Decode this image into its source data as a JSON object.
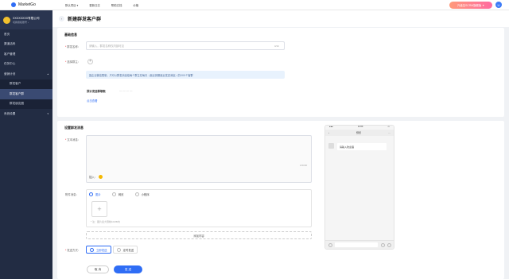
{
  "topbar": {
    "brand": "MarketGo",
    "nav": [
      "默认项目 ▾",
      "更新日志",
      "帮助文档",
      "价格"
    ],
    "upgrade": "升级至SCRM旗舰版 ✦",
    "avatar": "U"
  },
  "sidebar": {
    "org_name": "XXXXXXXX有限公司",
    "org_sub": "切换授权账号 ›",
    "items": [
      {
        "label": "首页"
      },
      {
        "label": "渠道活码"
      },
      {
        "label": "客户管理"
      },
      {
        "label": "任务中心"
      },
      {
        "label": "营销计划",
        "chev": "▴"
      },
      {
        "label": "群发客户"
      },
      {
        "label": "群发客户群"
      },
      {
        "label": "群发朋友圈"
      },
      {
        "label": "系统设置",
        "chev": "▾"
      }
    ]
  },
  "header": {
    "title": "新建群发客户群",
    "back": "‹"
  },
  "basic": {
    "title": "基础信息",
    "task_name_label": "群发名称：",
    "task_name_placeholder": "请输入，群发名称仅内部可见",
    "task_name_count": "0/30",
    "owner_label": "选择群主：",
    "owner_add": "+",
    "tip": "因企业微信限制，只可以群发消息给每个群主在每天（最近到期最近发送消息）的XXX个客群",
    "estimate_label": "预计发送群聊数",
    "estimate_value": "— — — —",
    "refresh": "点击查看"
  },
  "content": {
    "title": "设置群发消息",
    "text_label": "文本消息：",
    "text_count": "0/4000",
    "insert": "插入：",
    "attach_label": "附件消息：",
    "attach_options": [
      "图片",
      "网页",
      "小程序"
    ],
    "upload_icon": "+",
    "upload_note": "* 注：图片最大限制10MB内",
    "add_content": "添加内容",
    "send_label": "发送方式：",
    "send_options": [
      "立即发送",
      "定时发送"
    ],
    "cancel": "取 消",
    "submit": "发 送"
  },
  "preview": {
    "time": "12:00",
    "title": "预览",
    "message": "请输入欢迎语"
  }
}
